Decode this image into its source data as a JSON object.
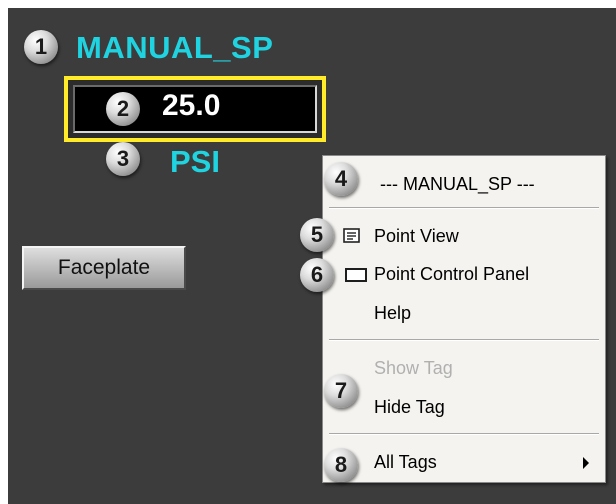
{
  "display": {
    "tag_name": "MANUAL_SP",
    "value": "25.0",
    "units": "PSI",
    "faceplate_button": "Faceplate"
  },
  "callouts": [
    "1",
    "2",
    "3",
    "4",
    "5",
    "6",
    "7",
    "8"
  ],
  "context_menu": {
    "header": "--- MANUAL_SP ---",
    "items": {
      "point_view": "Point View",
      "point_control_panel": "Point Control Panel",
      "help": "Help",
      "show_tag": "Show Tag",
      "hide_tag": "Hide Tag",
      "all_tags": "All Tags"
    }
  },
  "colors": {
    "background": "#3c3c3c",
    "cyan_text": "#1fd3e0",
    "value_border": "#ffeb2a",
    "menu_background": "#f4f3ef"
  },
  "icons": {
    "point_view": "point-view-icon",
    "point_control_panel": "point-control-panel-icon",
    "submenu_arrow": "submenu-arrow-icon"
  }
}
